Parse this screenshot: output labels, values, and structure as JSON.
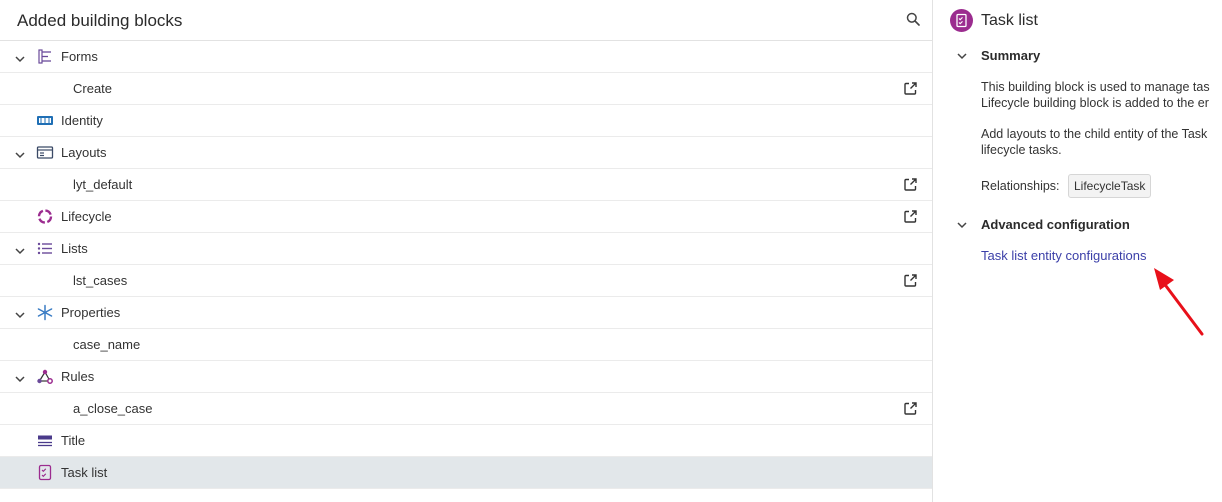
{
  "left_panel": {
    "title": "Added building blocks",
    "rows": [
      {
        "label": "Forms",
        "icon": "forms-icon",
        "expandable": true
      },
      {
        "label": "Create",
        "child": true,
        "open_link": true
      },
      {
        "label": "Identity",
        "icon": "identity-icon"
      },
      {
        "label": "Layouts",
        "icon": "layouts-icon",
        "expandable": true
      },
      {
        "label": "lyt_default",
        "child": true,
        "open_link": true
      },
      {
        "label": "Lifecycle",
        "icon": "lifecycle-icon",
        "open_link": true
      },
      {
        "label": "Lists",
        "icon": "lists-icon",
        "expandable": true
      },
      {
        "label": "lst_cases",
        "child": true,
        "open_link": true
      },
      {
        "label": "Properties",
        "icon": "properties-icon",
        "expandable": true
      },
      {
        "label": "case_name",
        "child": true
      },
      {
        "label": "Rules",
        "icon": "rules-icon",
        "expandable": true
      },
      {
        "label": "a_close_case",
        "child": true,
        "open_link": true
      },
      {
        "label": "Title",
        "icon": "title-icon"
      },
      {
        "label": "Task list",
        "icon": "task-list-icon",
        "selected": true
      }
    ]
  },
  "right_panel": {
    "title": "Task list",
    "summary": {
      "heading": "Summary",
      "para1_line1": "This building block is used to manage tas",
      "para1_line2": "Lifecycle building block is added to the er",
      "para2_line1": "Add layouts to the child entity of the Task",
      "para2_line2": "lifecycle tasks.",
      "relationships_label": "Relationships:",
      "relationship_chip": "LifecycleTask"
    },
    "advanced": {
      "heading": "Advanced configuration",
      "link": "Task list entity configurations"
    }
  },
  "colors": {
    "accent_purple": "#9b2c8f",
    "link": "#3b3fa8",
    "selected_row": "#e2e7ea",
    "icon_blue": "#1f6fb5",
    "arrow_red": "#e8101a"
  }
}
